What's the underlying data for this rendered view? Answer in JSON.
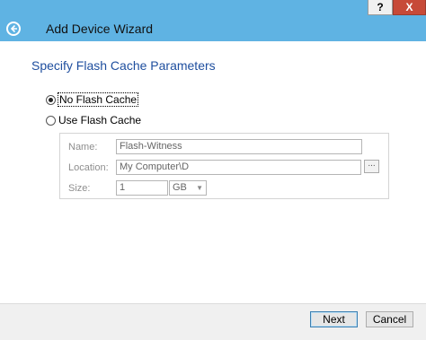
{
  "window": {
    "help_label": "?",
    "close_label": "X",
    "title": "Add Device Wizard",
    "back_icon": "back-arrow-icon"
  },
  "page": {
    "heading": "Specify Flash Cache Parameters"
  },
  "options": {
    "no_cache_label": "No Flash Cache",
    "use_cache_label": "Use Flash Cache",
    "selected": "No Flash Cache"
  },
  "fields": {
    "name_label": "Name:",
    "name_value": "Flash-Witness",
    "location_label": "Location:",
    "location_value": "My Computer\\D",
    "browse_label": "...",
    "size_label": "Size:",
    "size_value": "1",
    "size_unit": "GB"
  },
  "footer": {
    "next_label": "Next",
    "cancel_label": "Cancel"
  },
  "colors": {
    "titlebar": "#5fb3e3",
    "heading": "#1e4e9e",
    "close": "#c74a38"
  }
}
